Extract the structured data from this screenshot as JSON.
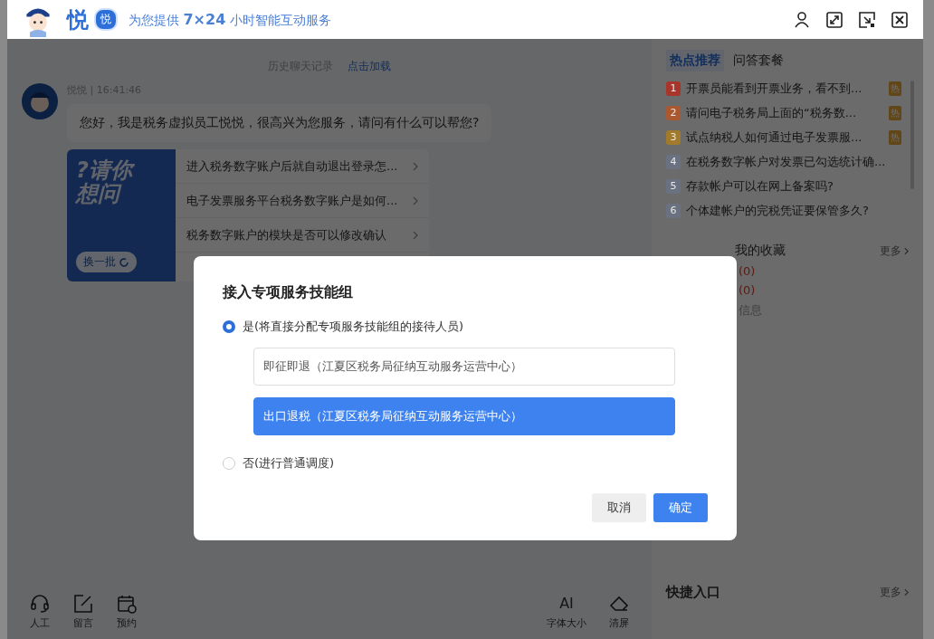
{
  "header": {
    "brand": "悦",
    "badge": "悦",
    "slogan_prefix": "为您提供",
    "slogan_highlight": "7×24",
    "slogan_suffix": "小时智能互动服务"
  },
  "chat": {
    "history_label": "历史聊天记录",
    "history_link": "点击加载",
    "message": {
      "sender": "悦悦 | 16:41:46",
      "text": "您好，我是税务虚拟员工悦悦，很高兴为您服务，请问有什么可以帮您?"
    },
    "suggest": {
      "banner": "?请你想问",
      "refresh": "换一批",
      "questions": [
        "进入税务数字账户后就自动退出登录怎...",
        "电子发票服务平台税务数字账户是如何...",
        "税务数字账户的模块是否可以修改确认"
      ]
    }
  },
  "toolbar_left": [
    {
      "label": "人工",
      "kind": "headset"
    },
    {
      "label": "留言",
      "kind": "edit"
    },
    {
      "label": "预约",
      "kind": "calendar"
    }
  ],
  "toolbar_right": [
    {
      "label": "字体大小",
      "kind": "font",
      "glyph": "AI"
    },
    {
      "label": "清屏",
      "kind": "eraser"
    }
  ],
  "side": {
    "tabs": [
      {
        "label": "热点推荐",
        "selected": true
      },
      {
        "label": "问答套餐",
        "selected": false
      }
    ],
    "hot": [
      {
        "rank": "1",
        "text": "开票员能看到开票业务，看不到...",
        "color": "#a8352a",
        "hot": true,
        "badge": "热"
      },
      {
        "rank": "2",
        "text": "请问电子税务局上面的“税务数...",
        "color": "#a9582f",
        "hot": true,
        "badge": "热"
      },
      {
        "rank": "3",
        "text": "试点纳税人如何通过电子发票服...",
        "color": "#a27a2c",
        "hot": true,
        "badge": "热"
      },
      {
        "rank": "4",
        "text": "在税务数字帐户对发票已勾选统计确...",
        "color": "#6a7180",
        "hot": false
      },
      {
        "rank": "5",
        "text": "存款帐户可以在网上备案吗?",
        "color": "#6a7180",
        "hot": false
      },
      {
        "rank": "6",
        "text": "个体建帐户的完税凭证要保管多久?",
        "color": "#6a7180",
        "hot": false
      }
    ],
    "favorites": {
      "title": "我的收藏",
      "more": "更多",
      "counts": [
        "(0)",
        "(0)"
      ],
      "info": "信息"
    },
    "quick": {
      "title": "快捷入口",
      "more": "更多"
    }
  },
  "dialog": {
    "title": "接入专项服务技能组",
    "options": [
      {
        "label": "是(将直接分配专项服务技能组的接待人员)",
        "selected": true
      },
      {
        "label": "否(进行普通调度)",
        "selected": false
      }
    ],
    "groups": [
      {
        "label": "即征即退（江夏区税务局征纳互动服务运营中心）",
        "selected": false
      },
      {
        "label": "出口退税（江夏区税务局征纳互动服务运营中心）",
        "selected": true
      }
    ],
    "buttons": [
      {
        "label": "取消",
        "kind": "secondary"
      },
      {
        "label": "确定",
        "kind": "primary"
      }
    ]
  }
}
